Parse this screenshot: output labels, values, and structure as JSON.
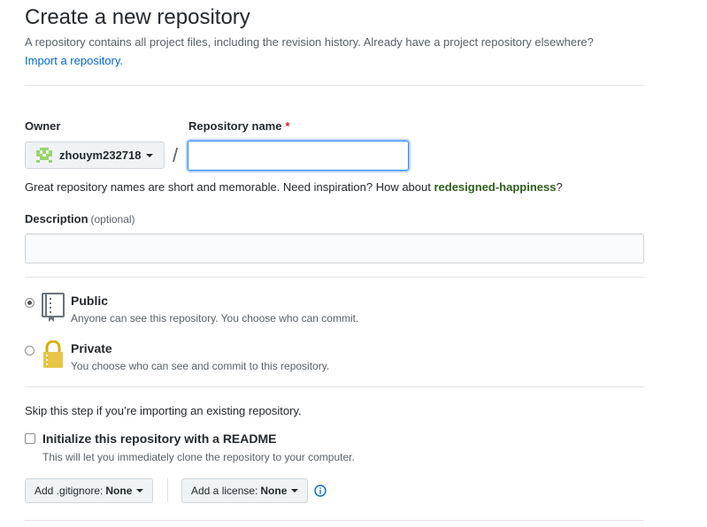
{
  "header": {
    "title": "Create a new repository",
    "subtitle": "A repository contains all project files, including the revision history. Already have a project repository elsewhere?",
    "import_link": "Import a repository."
  },
  "owner": {
    "label": "Owner",
    "value": "zhouym232718",
    "avatar_icon": "identicon"
  },
  "separator": "/",
  "repo_name": {
    "label": "Repository name",
    "required_mark": "*",
    "value": "",
    "placeholder": ""
  },
  "hint": {
    "text": "Great repository names are short and memorable. Need inspiration? How about ",
    "suggestion": "redesigned-happiness",
    "suffix": "?"
  },
  "description": {
    "label": "Description",
    "optional": "(optional)",
    "value": ""
  },
  "visibility": {
    "public": {
      "title": "Public",
      "desc": "Anyone can see this repository. You choose who can commit.",
      "icon": "repo-book-icon",
      "selected": true
    },
    "private": {
      "title": "Private",
      "desc": "You choose who can see and commit to this repository.",
      "icon": "lock-icon",
      "selected": false
    }
  },
  "init": {
    "skip_text": "Skip this step if you’re importing an existing repository.",
    "readme_label": "Initialize this repository with a README",
    "readme_desc": "This will let you immediately clone the repository to your computer.",
    "readme_checked": false
  },
  "gitignore": {
    "prefix": "Add .gitignore:",
    "value": "None"
  },
  "license": {
    "prefix": "Add a license:",
    "value": "None"
  },
  "colors": {
    "link": "#0366d6",
    "suggestion": "#2c5e1a",
    "required": "#cb2431",
    "identicon": "#9bd46d"
  }
}
